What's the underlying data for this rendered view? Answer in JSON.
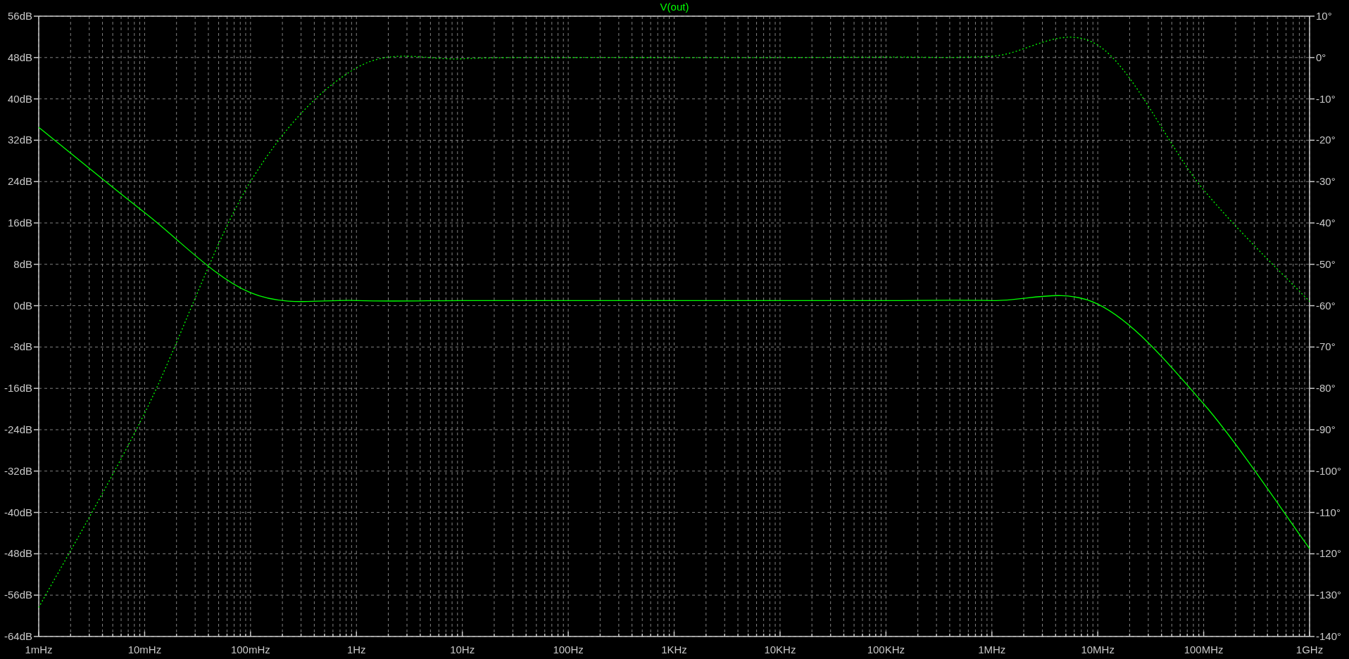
{
  "plot": {
    "chart_data": {
      "type": "line",
      "title": "V(out)",
      "categories": [
        "1mHz",
        "10mHz",
        "100mHz",
        "1Hz",
        "10Hz",
        "100Hz",
        "1KHz",
        "10KHz",
        "100KHz",
        "1MHz",
        "10MHz",
        "100MHz",
        "1GHz"
      ],
      "grid": true,
      "ylim": [
        -64,
        56
      ],
      "yticks": [
        {
          "value": 56,
          "label": "56dB"
        },
        {
          "value": 48,
          "label": "48dB"
        },
        {
          "value": 40,
          "label": "40dB"
        },
        {
          "value": 32,
          "label": "32dB"
        },
        {
          "value": 24,
          "label": "24dB"
        },
        {
          "value": 16,
          "label": "16dB"
        },
        {
          "value": 8,
          "label": "8dB"
        },
        {
          "value": 0,
          "label": "0dB"
        },
        {
          "value": -8,
          "label": "-8dB"
        },
        {
          "value": -16,
          "label": "-16dB"
        },
        {
          "value": -24,
          "label": "-24dB"
        },
        {
          "value": -32,
          "label": "-32dB"
        },
        {
          "value": -40,
          "label": "-40dB"
        },
        {
          "value": -48,
          "label": "-48dB"
        },
        {
          "value": -56,
          "label": "-56dB"
        },
        {
          "value": -64,
          "label": "-64dB"
        }
      ],
      "y2lim": [
        -140,
        10
      ],
      "y2ticks": [
        {
          "value": 10,
          "label": "10°"
        },
        {
          "value": 0,
          "label": "0°"
        },
        {
          "value": -10,
          "label": "-10°"
        },
        {
          "value": -20,
          "label": "-20°"
        },
        {
          "value": -30,
          "label": "-30°"
        },
        {
          "value": -40,
          "label": "-40°"
        },
        {
          "value": -50,
          "label": "-50°"
        },
        {
          "value": -60,
          "label": "-60°"
        },
        {
          "value": -70,
          "label": "-70°"
        },
        {
          "value": -80,
          "label": "-80°"
        },
        {
          "value": -90,
          "label": "-90°"
        },
        {
          "value": -100,
          "label": "-100°"
        },
        {
          "value": -110,
          "label": "-110°"
        },
        {
          "value": -120,
          "label": "-120°"
        },
        {
          "value": -130,
          "label": "-130°"
        },
        {
          "value": -140,
          "label": "-140°"
        }
      ],
      "series": [
        {
          "color": "#00ff00",
          "line_style": "solid",
          "values": [
            34.5,
            18,
            2.5,
            1,
            1,
            1,
            1,
            1,
            1,
            1,
            0.3,
            -19,
            -47
          ]
        },
        {
          "color": "#00ff00",
          "axis": "y2",
          "line_style": "dotted",
          "values": [
            -133,
            -86,
            -30,
            -2.5,
            -0.3,
            0,
            0,
            0,
            0.1,
            0.3,
            3,
            -32,
            -59
          ]
        }
      ]
    }
  }
}
